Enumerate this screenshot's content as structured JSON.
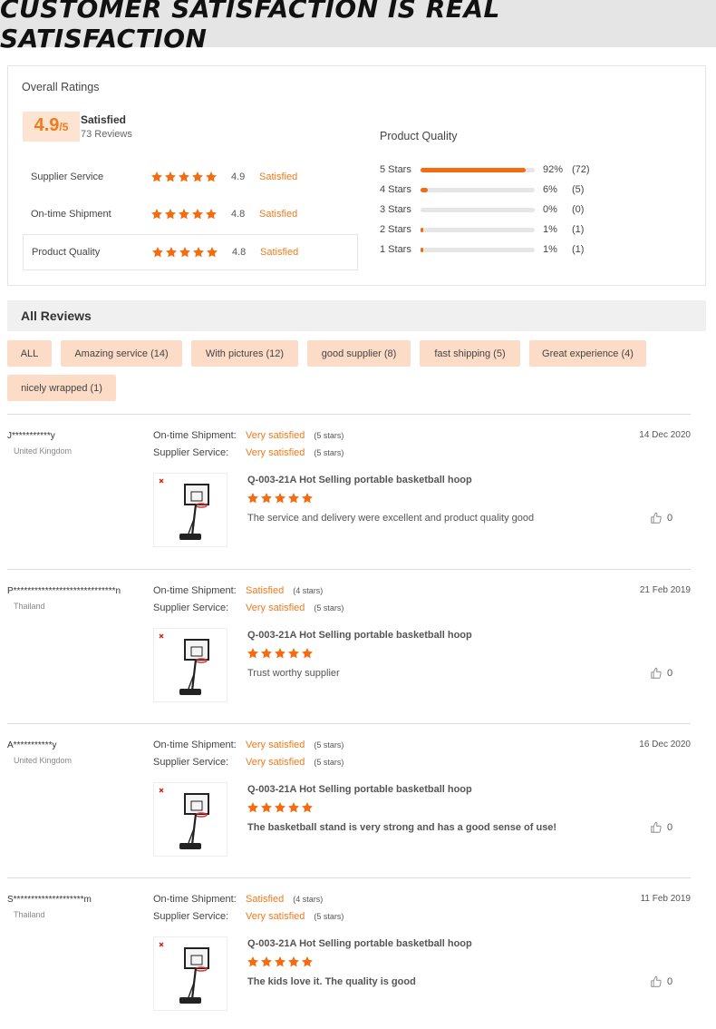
{
  "banner": {
    "title": "CUSTOMER SATISFACTION IS REAL SATISFACTION"
  },
  "overall": {
    "title": "Overall Ratings",
    "score": "4.9",
    "score_of": "/5",
    "status": "Satisfied",
    "reviews_count": "73 Reviews",
    "metrics": [
      {
        "label": "Supplier Service",
        "rating": 5,
        "score": "4.9",
        "status": "Satisfied"
      },
      {
        "label": "On-time Shipment",
        "rating": 5,
        "score": "4.8",
        "status": "Satisfied"
      },
      {
        "label": "Product Quality",
        "rating": 5,
        "score": "4.8",
        "status": "Satisfied"
      }
    ]
  },
  "product_quality": {
    "title": "Product Quality",
    "rows": [
      {
        "label": "5 Stars",
        "fraction": 0.92,
        "pct": "92%",
        "count": "(72)"
      },
      {
        "label": "4 Stars",
        "fraction": 0.06,
        "pct": "6%",
        "count": "(5)"
      },
      {
        "label": "3 Stars",
        "fraction": 0.0,
        "pct": "0%",
        "count": "(0)"
      },
      {
        "label": "2 Stars",
        "fraction": 0.01,
        "pct": "1%",
        "count": "(1)"
      },
      {
        "label": "1 Stars",
        "fraction": 0.01,
        "pct": "1%",
        "count": "(1)"
      }
    ]
  },
  "all_reviews": {
    "title": "All Reviews",
    "filters": [
      "ALL",
      "Amazing service (14)",
      "With pictures (12)",
      "good supplier (8)",
      "fast shipping (5)",
      "Great experience (4)",
      "nicely wrapped (1)"
    ]
  },
  "labels": {
    "shipment": "On-time Shipment:",
    "service": "Supplier Service:"
  },
  "colors": {
    "accent": "#f07a1c",
    "chip": "#fcdcc7",
    "bar": "#f56b10"
  },
  "reviews": [
    {
      "user": "J***********y",
      "country": "United Kingdom",
      "date": "14 Dec 2020",
      "shipment_value": "Very satisfied",
      "shipment_stars": "(5 stars)",
      "service_value": "Very satisfied",
      "service_stars": "(5 stars)",
      "product": "Q-003-21A Hot Selling portable basketball hoop",
      "rating": 5,
      "text": "The service and delivery were excellent and product quality good",
      "likes": "0"
    },
    {
      "user": "P*****************************n",
      "country": "Thailand",
      "date": "21 Feb 2019",
      "shipment_value": "Satisfied",
      "shipment_stars": "(4 stars)",
      "service_value": "Very satisfied",
      "service_stars": "(5 stars)",
      "product": "Q-003-21A Hot Selling portable basketball hoop",
      "rating": 5,
      "text": "Trust worthy supplier",
      "likes": "0"
    },
    {
      "user": "A***********y",
      "country": "United Kingdom",
      "date": "16 Dec 2020",
      "shipment_value": "Very satisfied",
      "shipment_stars": "(5 stars)",
      "service_value": "Very satisfied",
      "service_stars": "(5 stars)",
      "product": "Q-003-21A Hot Selling portable basketball hoop",
      "rating": 5,
      "text": "The basketball stand is very strong and has a good sense of use!",
      "likes": "0"
    },
    {
      "user": "S********************m",
      "country": "Thailand",
      "date": "11 Feb 2019",
      "shipment_value": "Satisfied",
      "shipment_stars": "(4 stars)",
      "service_value": "Very satisfied",
      "service_stars": "(5 stars)",
      "product": "Q-003-21A Hot Selling portable basketball hoop",
      "rating": 5,
      "text": "The kids love it. The quality is good",
      "likes": "0"
    }
  ]
}
